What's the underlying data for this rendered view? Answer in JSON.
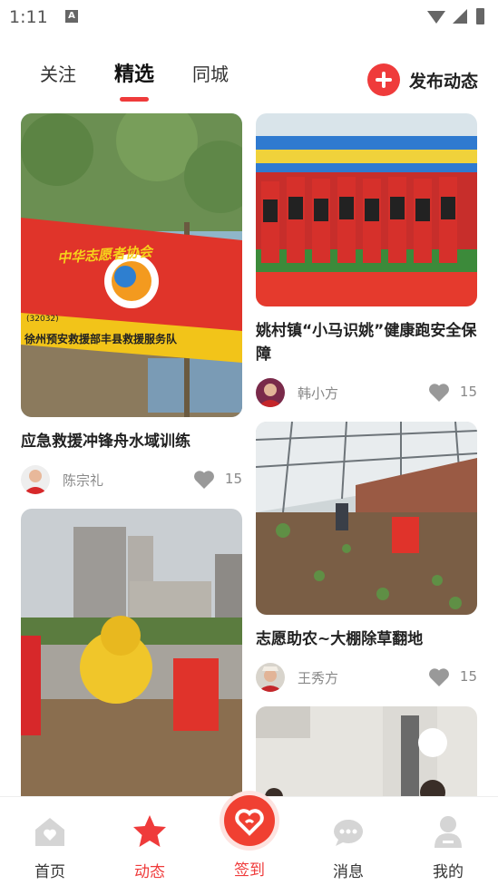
{
  "status": {
    "time": "1:11",
    "notification_letter": "A"
  },
  "tabs": [
    {
      "label": "关注",
      "active": false
    },
    {
      "label": "精选",
      "active": true
    },
    {
      "label": "同城",
      "active": false
    }
  ],
  "publish": {
    "label": "发布动态",
    "icon": "plus-circle-icon"
  },
  "feed": {
    "left": [
      {
        "title": "应急救援冲锋舟水域训练",
        "author": "陈宗礼",
        "likes": "15",
        "image_text": [
          "中华志愿者协会",
          "(32032)",
          "徐州预安救援部丰县救援服务队"
        ]
      },
      {
        "title": "",
        "author": "",
        "likes": ""
      }
    ],
    "right": [
      {
        "title": "姚村镇“小马识姚”健康跑安全保障",
        "author": "韩小方",
        "likes": "15"
      },
      {
        "title": "志愿助农~大棚除草翻地",
        "author": "王秀方",
        "likes": "15"
      },
      {
        "title": "",
        "author": "",
        "likes": ""
      }
    ]
  },
  "nav": [
    {
      "label": "首页",
      "icon": "home-icon",
      "active": false
    },
    {
      "label": "动态",
      "icon": "star-icon",
      "active": true
    },
    {
      "label": "签到",
      "icon": "checkin-heart-icon",
      "active": false
    },
    {
      "label": "消息",
      "icon": "chat-bubble-icon",
      "active": false
    },
    {
      "label": "我的",
      "icon": "person-icon",
      "active": false
    }
  ],
  "colors": {
    "accent": "#ef3b3b",
    "text": "#222222",
    "muted": "#888888"
  }
}
